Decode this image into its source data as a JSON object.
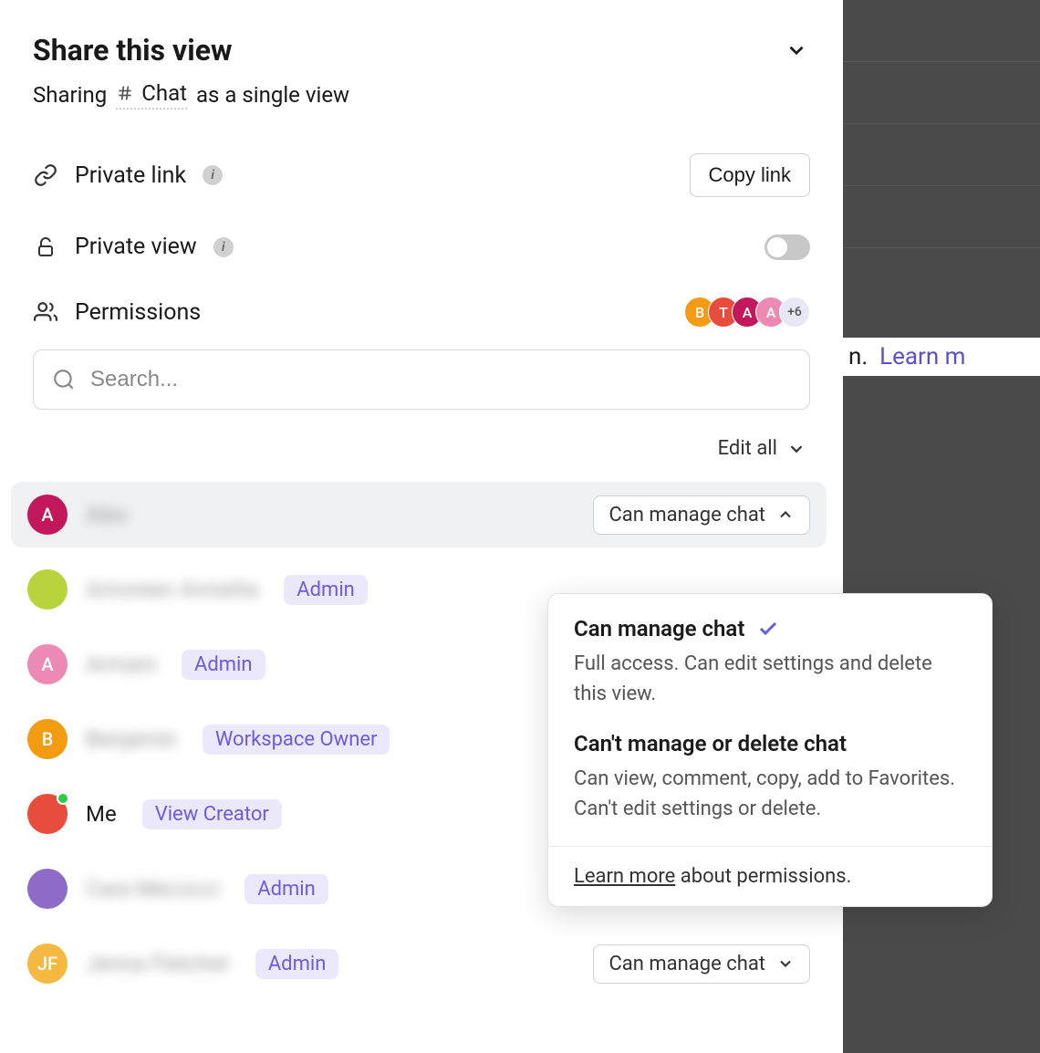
{
  "backdrop": {
    "text_suffix": "n.",
    "learn_text": "Learn m"
  },
  "header": {
    "title": "Share this view"
  },
  "subtitle": {
    "prefix": "Sharing",
    "view_name": "Chat",
    "suffix": "as a single view"
  },
  "private_link": {
    "label": "Private link",
    "copy_button": "Copy link"
  },
  "private_view": {
    "label": "Private view",
    "enabled": false
  },
  "permissions": {
    "label": "Permissions",
    "avatars": [
      {
        "initial": "B",
        "color": "#f39c12"
      },
      {
        "initial": "T",
        "color": "#e74c3c"
      },
      {
        "initial": "A",
        "color": "#c2185b"
      },
      {
        "initial": "A",
        "color": "#ec8ab5"
      }
    ],
    "more_count": "+6"
  },
  "search": {
    "placeholder": "Search..."
  },
  "edit_all": {
    "label": "Edit all"
  },
  "users": [
    {
      "name": "Alex",
      "initial": "A",
      "color": "#c2185b",
      "badge": null,
      "permission": "Can manage chat",
      "active": true,
      "show_perm": true,
      "chevron": "up",
      "blurred": true,
      "presence": false
    },
    {
      "name": "Amoreen Armetta",
      "initial": "",
      "color": "#b8d43c",
      "badge": "Admin",
      "permission": null,
      "active": false,
      "show_perm": false,
      "blurred": true,
      "presence": false,
      "photo": true
    },
    {
      "name": "Armani",
      "initial": "A",
      "color": "#ec8ab5",
      "badge": "Admin",
      "permission": null,
      "active": false,
      "show_perm": false,
      "blurred": true,
      "presence": false
    },
    {
      "name": "Benjamin",
      "initial": "B",
      "color": "#f39c12",
      "badge": "Workspace Owner",
      "permission": null,
      "active": false,
      "show_perm": false,
      "blurred": true,
      "presence": false
    },
    {
      "name": "Me",
      "initial": "",
      "color": "#e74c3c",
      "badge": "View Creator",
      "permission": null,
      "active": false,
      "show_perm": false,
      "blurred": false,
      "presence": true,
      "photo": true
    },
    {
      "name": "Cara Mecocci",
      "initial": "",
      "color": "#8e6bc7",
      "badge": "Admin",
      "permission": null,
      "active": false,
      "show_perm": false,
      "blurred": true,
      "presence": false,
      "photo": true
    },
    {
      "name": "Jenna Fletcher",
      "initial": "JF",
      "color": "#f5b942",
      "badge": "Admin",
      "permission": "Can manage chat",
      "active": false,
      "show_perm": true,
      "chevron": "down",
      "blurred": true,
      "presence": false
    }
  ],
  "popover": {
    "options": [
      {
        "title": "Can manage chat",
        "desc": "Full access. Can edit settings and delete this view.",
        "selected": true
      },
      {
        "title": "Can't manage or delete chat",
        "desc": "Can view, comment, copy, add to Favorites. Can't edit settings or delete.",
        "selected": false
      }
    ],
    "footer_link": "Learn more",
    "footer_text": " about permissions."
  }
}
